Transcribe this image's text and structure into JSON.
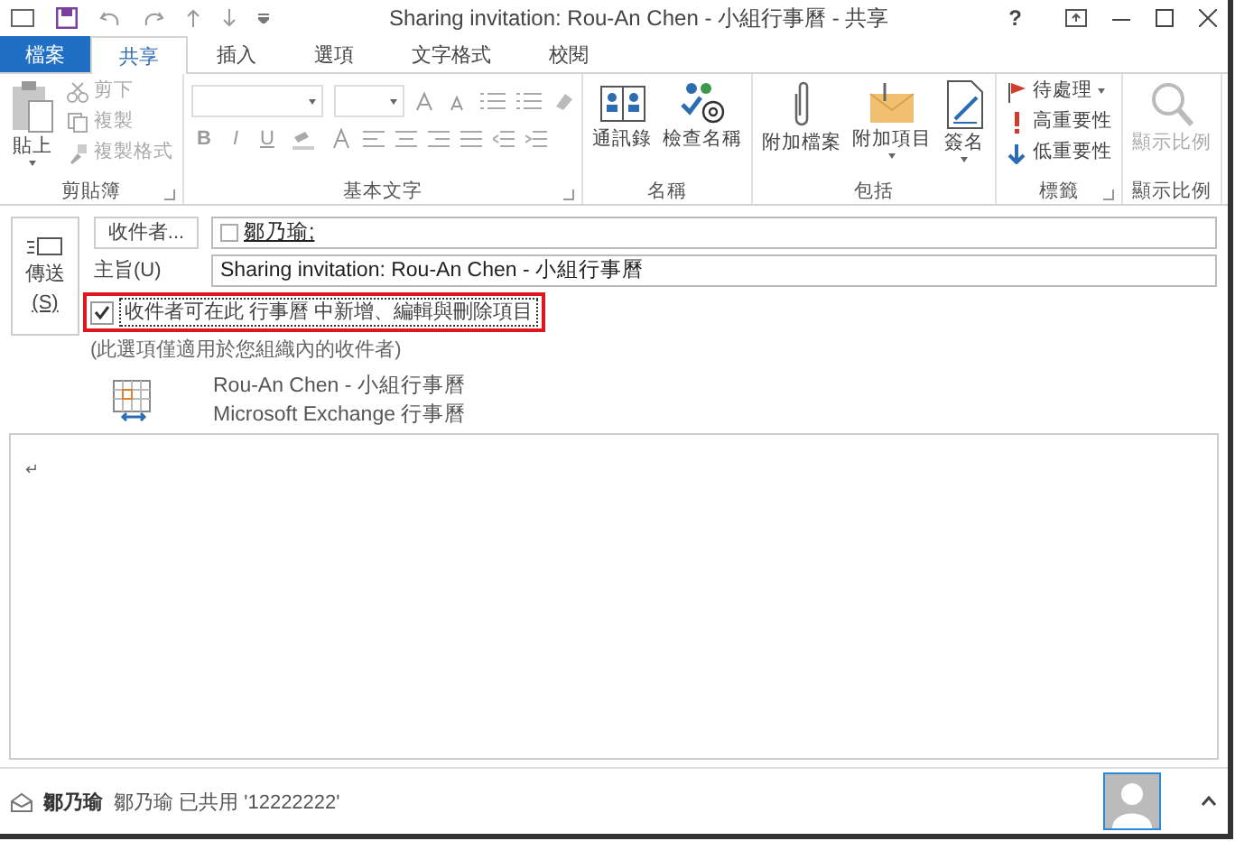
{
  "window": {
    "title": "Sharing invitation: Rou-An Chen - 小組行事曆 - 共享",
    "help": "?"
  },
  "tabs": [
    {
      "label": "檔案",
      "kind": "file",
      "selected": false
    },
    {
      "label": "共享",
      "kind": "tab",
      "selected": true
    },
    {
      "label": "插入",
      "kind": "tab",
      "selected": false
    },
    {
      "label": "選項",
      "kind": "tab",
      "selected": false
    },
    {
      "label": "文字格式",
      "kind": "tab",
      "selected": false
    },
    {
      "label": "校閱",
      "kind": "tab",
      "selected": false
    }
  ],
  "ribbon": {
    "groups": [
      {
        "label": "剪貼簿",
        "kind": "clipboard",
        "launcher": true,
        "items": [
          {
            "label": "貼上",
            "kind": "large",
            "dropdown": true,
            "disabled": false
          },
          {
            "label": "剪下",
            "kind": "small",
            "dropdown": false,
            "disabled": true
          },
          {
            "label": "複製",
            "kind": "small",
            "dropdown": false,
            "disabled": true
          },
          {
            "label": "複製格式",
            "kind": "small",
            "dropdown": false,
            "disabled": true
          }
        ]
      },
      {
        "label": "基本文字",
        "kind": "font",
        "launcher": true,
        "format_buttons": [
          "B",
          "I",
          "U"
        ],
        "disabled": true
      },
      {
        "label": "名稱",
        "kind": "names",
        "launcher": false,
        "items": [
          {
            "label": "通訊錄",
            "kind": "large",
            "dropdown": false,
            "disabled": false
          },
          {
            "label": "檢查名稱",
            "kind": "large",
            "dropdown": false,
            "disabled": false
          }
        ]
      },
      {
        "label": "包括",
        "kind": "include",
        "launcher": false,
        "items": [
          {
            "label": "附加檔案",
            "kind": "large",
            "dropdown": false,
            "disabled": false
          },
          {
            "label": "附加項目",
            "kind": "large",
            "dropdown": true,
            "disabled": false
          },
          {
            "label": "簽名",
            "kind": "large",
            "dropdown": true,
            "disabled": false
          }
        ]
      },
      {
        "label": "標籤",
        "kind": "tags",
        "launcher": true,
        "items": [
          {
            "label": "待處理",
            "kind": "small",
            "dropdown": true,
            "disabled": false
          },
          {
            "label": "高重要性",
            "kind": "small",
            "dropdown": false,
            "disabled": false
          },
          {
            "label": "低重要性",
            "kind": "small",
            "dropdown": false,
            "disabled": false
          }
        ]
      },
      {
        "label": "顯示比例",
        "kind": "zoom",
        "launcher": false,
        "items": [
          {
            "label": "顯示比例",
            "kind": "large",
            "dropdown": false,
            "disabled": true
          }
        ]
      }
    ]
  },
  "send": {
    "label": "傳送",
    "accel": "(S)"
  },
  "to": {
    "button": "收件者...",
    "recipients": [
      "鄒乃瑜;"
    ]
  },
  "subject": {
    "label": "主旨(U)",
    "value": "Sharing invitation: Rou-An Chen - 小組行事曆"
  },
  "permission": {
    "label": "收件者可在此 行事曆 中新增、編輯與刪除項目",
    "checked": true,
    "highlighted": true
  },
  "note": "(此選項僅適用於您組織內的收件者)",
  "calendar": {
    "name": "Rou-An Chen - 小組行事曆",
    "source": "Microsoft Exchange 行事曆"
  },
  "body": {
    "text": "↵"
  },
  "status": {
    "sender": "鄒乃瑜",
    "message": "鄒乃瑜 已共用 '12222222'"
  }
}
